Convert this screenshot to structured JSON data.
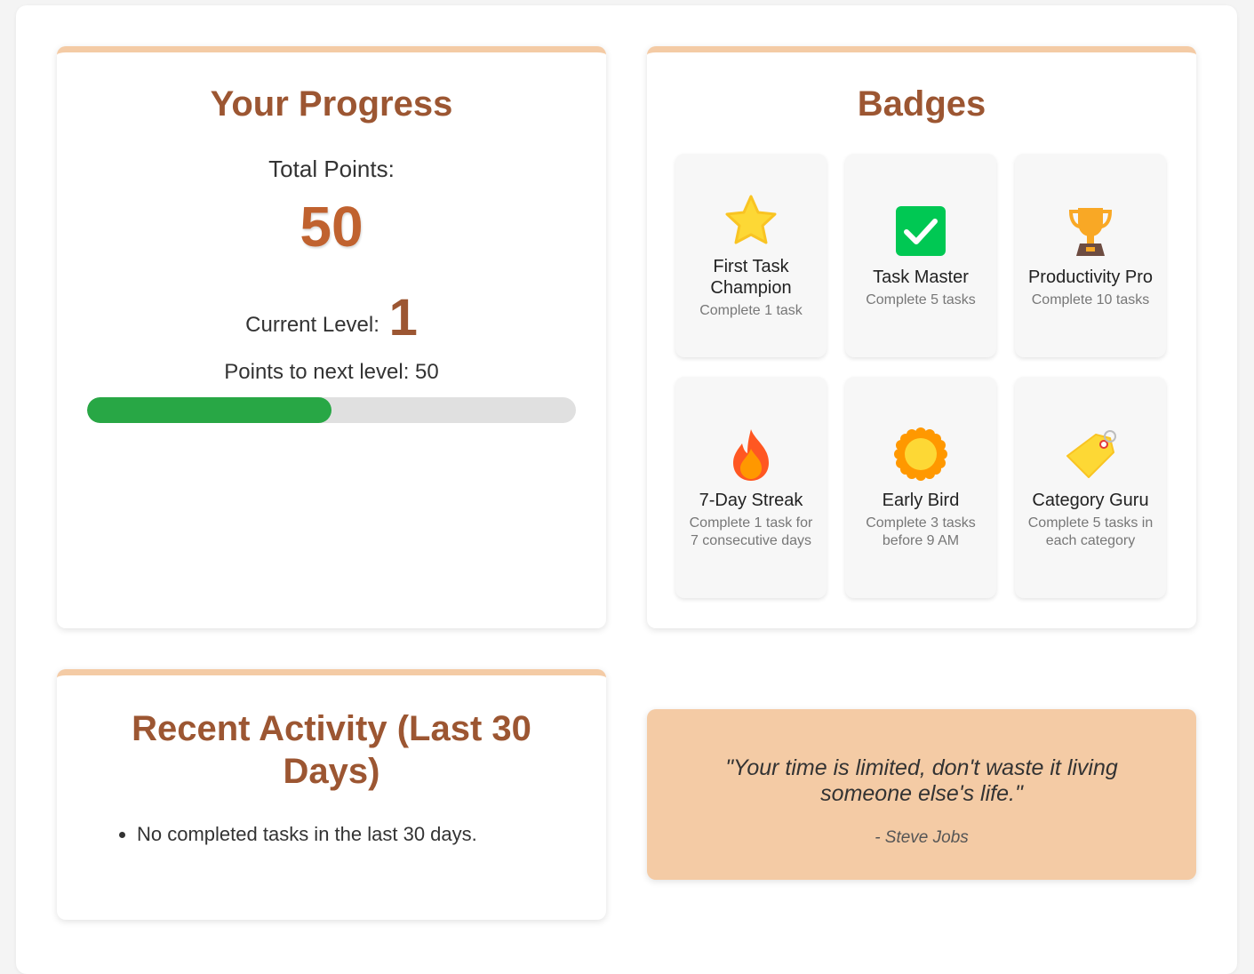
{
  "progress": {
    "title": "Your Progress",
    "total_label": "Total Points:",
    "total_points": "50",
    "level_label": "Current Level:",
    "level": "1",
    "next_level_text": "Points to next level: 50",
    "progress_fraction": 0.5,
    "progress_color": "#28a745"
  },
  "badges": {
    "title": "Badges",
    "items": [
      {
        "name": "First Task Champion",
        "description": "Complete 1 task",
        "icon": "star-icon"
      },
      {
        "name": "Task Master",
        "description": "Complete 5 tasks",
        "icon": "checkmark-icon"
      },
      {
        "name": "Productivity Pro",
        "description": "Complete 10 tasks",
        "icon": "trophy-icon"
      },
      {
        "name": "7-Day Streak",
        "description": "Complete 1 task for 7 consecutive days",
        "icon": "fire-icon"
      },
      {
        "name": "Early Bird",
        "description": "Complete 3 tasks before 9 AM",
        "icon": "sun-icon"
      },
      {
        "name": "Category Guru",
        "description": "Complete 5 tasks in each category",
        "icon": "tag-icon"
      }
    ]
  },
  "activity": {
    "title": "Recent Activity (Last 30 Days)",
    "items": [
      "No completed tasks in the last 30 days."
    ]
  },
  "quote": {
    "text": "\"Your time is limited, don't waste it living someone else's life.\"",
    "author": "- Steve Jobs"
  },
  "colors": {
    "accent_brown": "#9c5632",
    "points_orange": "#c0622f",
    "card_top_border": "#f4cba5",
    "quote_background": "#f4cba5"
  }
}
